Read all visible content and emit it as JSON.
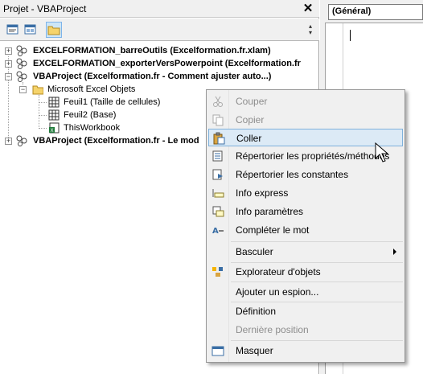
{
  "project_pane": {
    "title": "Projet - VBAProject",
    "close_glyph": "✕"
  },
  "tree": {
    "nodes": [
      {
        "label": "EXCELFORMATION_barreOutils (Excelformation.fr.xlam)",
        "expander": "+",
        "bold": true
      },
      {
        "label": "EXCELFORMATION_exporterVersPowerpoint (Excelformation.fr",
        "expander": "+",
        "bold": true
      },
      {
        "label": "VBAProject (Excelformation.fr - Comment ajuster auto...)",
        "expander": "−",
        "bold": true
      },
      {
        "label": "Microsoft Excel Objets",
        "expander": "−",
        "bold": false
      },
      {
        "label": "Feuil1 (Taille de cellules)",
        "bold": false
      },
      {
        "label": "Feuil2 (Base)",
        "bold": false
      },
      {
        "label": "ThisWorkbook",
        "bold": false
      },
      {
        "label": "VBAProject (Excelformation.fr - Le mod",
        "expander": "+",
        "bold": true
      }
    ]
  },
  "code_pane": {
    "object_combo": "(Général)"
  },
  "context_menu": {
    "items": [
      {
        "label": "Couper",
        "icon": "scissors-icon",
        "enabled": false
      },
      {
        "label": "Copier",
        "icon": "copy-icon",
        "enabled": false
      },
      {
        "label": "Coller",
        "icon": "paste-icon",
        "enabled": true,
        "highlighted": true
      },
      {
        "label": "Répertorier les propriétés/méthodes",
        "icon": "list-properties-icon",
        "enabled": true
      },
      {
        "label": "Répertorier les constantes",
        "icon": "list-constants-icon",
        "enabled": true
      },
      {
        "label": "Info express",
        "icon": "quick-info-icon",
        "enabled": true
      },
      {
        "label": "Info paramètres",
        "icon": "parameter-info-icon",
        "enabled": true
      },
      {
        "label": "Compléter le mot",
        "icon": "complete-word-icon",
        "enabled": true
      },
      {
        "label": "Basculer",
        "icon": "",
        "enabled": true,
        "submenu": true
      },
      {
        "label": "Explorateur d'objets",
        "icon": "object-browser-icon",
        "enabled": true
      },
      {
        "label": "Ajouter un espion...",
        "icon": "",
        "enabled": true
      },
      {
        "label": "Définition",
        "icon": "",
        "enabled": true
      },
      {
        "label": "Dernière position",
        "icon": "",
        "enabled": false
      },
      {
        "label": "Masquer",
        "icon": "hide-window-icon",
        "enabled": true
      }
    ]
  },
  "colors": {
    "menu_highlight": "#dceaf6",
    "menu_highlight_border": "#7fb1db",
    "disabled_text": "#8d8d8d"
  }
}
